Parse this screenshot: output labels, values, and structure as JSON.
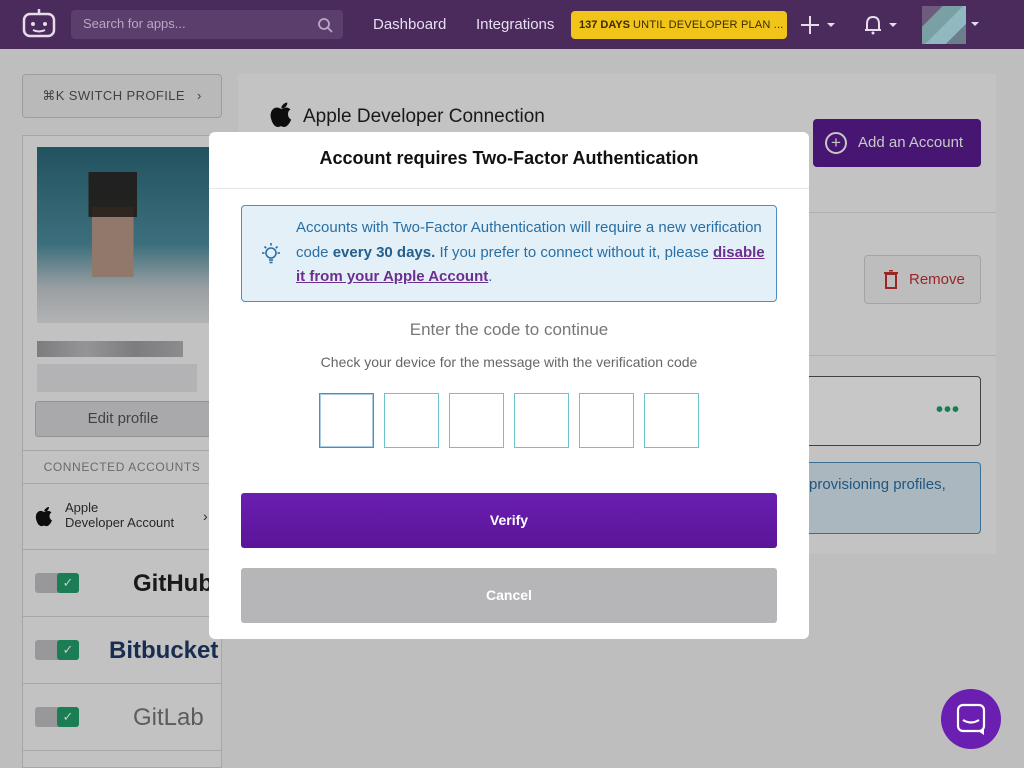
{
  "topbar": {
    "search_placeholder": "Search for apps...",
    "nav": [
      "Dashboard",
      "Integrations"
    ],
    "trial_days": "137 DAYS",
    "trial_text": "UNTIL DEVELOPER PLAN ...",
    "colors": {
      "bar": "#4b2a5c",
      "badge": "#f0c419"
    }
  },
  "sidebar": {
    "switch_profile": "⌘K  SWITCH PROFILE",
    "edit_profile": "Edit profile",
    "connected_header": "CONNECTED ACCOUNTS",
    "apple_account": "Apple\nDeveloper Account",
    "brands": [
      "GitHub",
      "Bitbucket",
      "GitLab"
    ]
  },
  "main": {
    "title": "Apple Developer Connection",
    "add_account": "Add an Account",
    "remove": "Remove",
    "info_snippet": "provisioning profiles,"
  },
  "modal": {
    "title": "Account requires Two-Factor Authentication",
    "notice_part1": "Accounts with Two-Factor Authentication will require a new verification code ",
    "notice_bold": "every 30 days.",
    "notice_part2": " If you prefer to connect without it, please ",
    "notice_link": "disable it from your Apple Account",
    "notice_end": ".",
    "code_heading": "Enter the code to continue",
    "code_sub": "Check your device for the message with the verification code",
    "code_digits": [
      "",
      "",
      "",
      "",
      "",
      ""
    ],
    "verify": "Verify",
    "cancel": "Cancel",
    "colors": {
      "primary": "#5b1499",
      "cancel": "#b6b6b8",
      "info": "#4a8fc2"
    }
  }
}
